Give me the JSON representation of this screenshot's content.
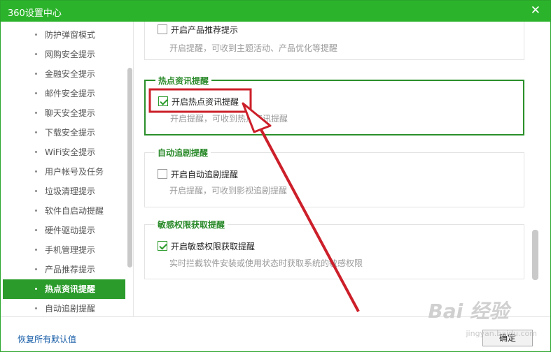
{
  "window": {
    "title": "360设置中心",
    "close_glyph": "✕"
  },
  "sidebar": {
    "items": [
      {
        "label": "防护弹窗模式"
      },
      {
        "label": "网购安全提示"
      },
      {
        "label": "金融安全提示"
      },
      {
        "label": "邮件安全提示"
      },
      {
        "label": "聊天安全提示"
      },
      {
        "label": "下载安全提示"
      },
      {
        "label": "WiFi安全提示"
      },
      {
        "label": "用户帐号及任务"
      },
      {
        "label": "垃圾清理提示"
      },
      {
        "label": "软件自启动提醒"
      },
      {
        "label": "硬件驱动提示"
      },
      {
        "label": "手机管理提示"
      },
      {
        "label": "产品推荐提示"
      },
      {
        "label": "热点资讯提醒",
        "active": true
      },
      {
        "label": "自动追剧提醒"
      }
    ]
  },
  "sections": [
    {
      "title": "",
      "option": "开启产品推荐提示",
      "checked": false,
      "desc": "开启提醒，可收到主题活动、产品优化等提醒"
    },
    {
      "title": "热点资讯提醒",
      "option": "开启热点资讯提醒",
      "checked": true,
      "desc": "开启提醒，可收到热点资讯提醒",
      "highlight": true
    },
    {
      "title": "自动追剧提醒",
      "option": "开启自动追剧提醒",
      "checked": false,
      "desc": "开启提醒，可收到影视追剧提醒"
    },
    {
      "title": "敏感权限获取提醒",
      "option": "开启敏感权限获取提醒",
      "checked": true,
      "desc": "实时拦截软件安装或使用状态时获取系统的敏感权限"
    }
  ],
  "footer": {
    "restore_label": "恢复所有默认值",
    "ok_label": "确定"
  },
  "watermark": {
    "main": "Bai 经验",
    "sub": "jingyan.baidu.com"
  },
  "colors": {
    "brand_green": "#2cb32c",
    "active_green": "#2b9b2b",
    "annotation_red": "#cc1f2a"
  }
}
